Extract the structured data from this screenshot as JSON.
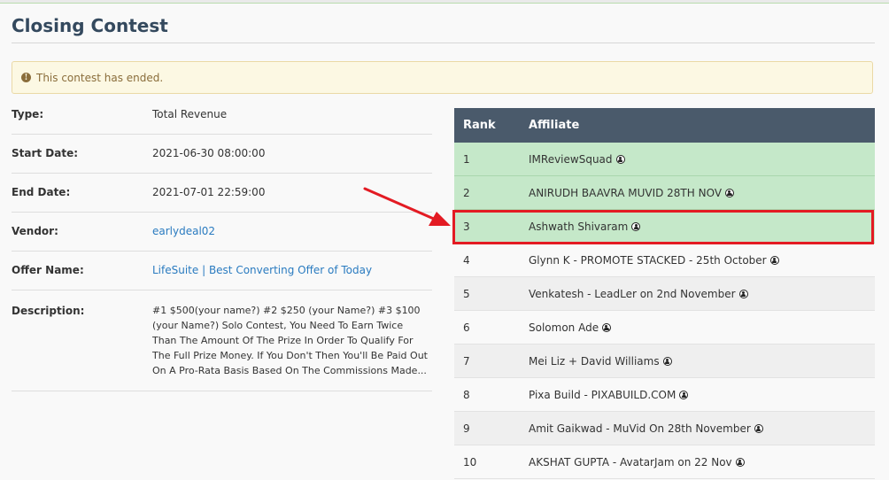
{
  "page": {
    "title": "Closing Contest",
    "alert": "This contest has ended."
  },
  "details": [
    {
      "label": "Type:",
      "value": "Total Revenue"
    },
    {
      "label": "Start Date:",
      "value": "2021-06-30 08:00:00"
    },
    {
      "label": "End Date:",
      "value": "2021-07-01 22:59:00"
    },
    {
      "label": "Vendor:",
      "value": "earlydeal02"
    },
    {
      "label": "Offer Name:",
      "value": "LifeSuite | Best Converting Offer of Today"
    },
    {
      "label": "Description:",
      "value": "#1 $500(your name?) #2 $250 (your Name?) #3 $100 (your Name?) Solo Contest, You Need To Earn Twice Than The Amount Of The Prize In Order To Qualify For The Full Prize Money. If You Don't Then You'll Be Paid Out On A Pro-Rata Basis Based On The Commissions Made..."
    }
  ],
  "leaderboard": {
    "headers": {
      "rank": "Rank",
      "affiliate": "Affiliate"
    },
    "rows": [
      {
        "rank": "1",
        "affiliate": "IMReviewSquad"
      },
      {
        "rank": "2",
        "affiliate": "ANIRUDH BAAVRA MUVID 28TH NOV"
      },
      {
        "rank": "3",
        "affiliate": "Ashwath Shivaram"
      },
      {
        "rank": "4",
        "affiliate": "Glynn K - PROMOTE STACKED - 25th October"
      },
      {
        "rank": "5",
        "affiliate": "Venkatesh - LeadLer on 2nd November"
      },
      {
        "rank": "6",
        "affiliate": "Solomon Ade"
      },
      {
        "rank": "7",
        "affiliate": "Mei Liz + David Williams"
      },
      {
        "rank": "8",
        "affiliate": "Pixa Build - PIXABUILD.COM"
      },
      {
        "rank": "9",
        "affiliate": "Amit Gaikwad - MuVid On 28th November"
      },
      {
        "rank": "10",
        "affiliate": "AKSHAT GUPTA - AvatarJam on 22 Nov"
      }
    ]
  },
  "colors": {
    "header_bg": "#4a5a6b",
    "winner_row": "#c5e8c9",
    "highlight": "#e31b23",
    "link": "#2a7bc0",
    "alert_bg": "#fcf8e3"
  },
  "icons": {
    "alert": "info-circle-icon",
    "affiliate": "user-circle-icon",
    "annotation": "red-arrow-icon"
  }
}
